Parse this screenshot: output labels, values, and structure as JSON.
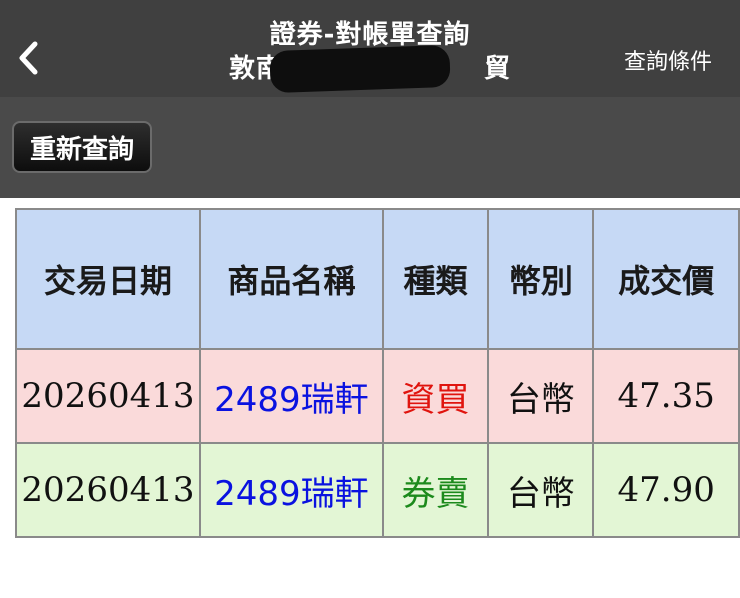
{
  "header": {
    "title_line1": "證券-對帳單查詢",
    "title_line2_prefix": "敦南-0",
    "title_line2_suffix": "貿",
    "query_conditions": "查詢條件"
  },
  "toolbar": {
    "requery_label": "重新查詢"
  },
  "table": {
    "headers": [
      "交易日期",
      "商品名稱",
      "種類",
      "幣別",
      "成交價"
    ],
    "rows": [
      {
        "date": "20260413",
        "product": "2489瑞軒",
        "type": "資買",
        "currency": "台幣",
        "price": "47.35"
      },
      {
        "date": "20260413",
        "product": "2489瑞軒",
        "type": "券賣",
        "currency": "台幣",
        "price": "47.90"
      }
    ]
  },
  "colors": {
    "header_bg": "#404040",
    "th_bg": "#c6d9f5",
    "buy_row": "#fadada",
    "sell_row": "#e3f6d5",
    "buy_text": "#e0140e",
    "sell_text": "#1c8a1c",
    "product_text": "#0a12e0"
  }
}
